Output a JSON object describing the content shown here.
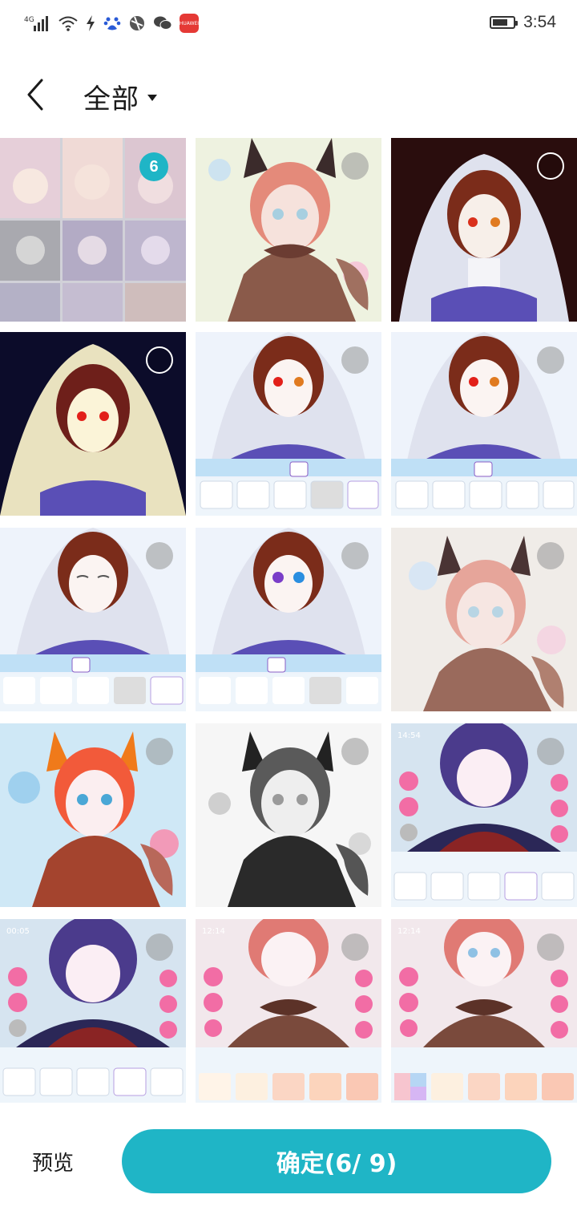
{
  "status_bar": {
    "network": "4G",
    "time": "3:54",
    "battery_level": 0.75,
    "badge_text": "HUAWEI"
  },
  "header": {
    "title": "全部"
  },
  "grid": {
    "selected_count_badge": "6",
    "items": [
      {
        "kind": "collage",
        "selected": true
      },
      {
        "kind": "fox",
        "selected": false
      },
      {
        "kind": "veil-dark",
        "selected": false
      },
      {
        "kind": "veil-navy",
        "selected": false
      },
      {
        "kind": "veil-editor-mouth",
        "selected": false
      },
      {
        "kind": "veil-editor-mouth2",
        "selected": false
      },
      {
        "kind": "veil-editor-eyes",
        "selected": false
      },
      {
        "kind": "veil-editor-eyes2",
        "selected": false
      },
      {
        "kind": "fox-pale",
        "selected": false
      },
      {
        "kind": "fox-bright",
        "selected": false
      },
      {
        "kind": "fox-bw",
        "selected": false
      },
      {
        "kind": "purple-editor",
        "selected": false
      },
      {
        "kind": "purple-editor-2",
        "selected": false
      },
      {
        "kind": "fox-editor",
        "selected": false
      },
      {
        "kind": "fox-editor-2",
        "selected": false
      }
    ],
    "timestamps": [
      "14:54",
      "00:05",
      "12:14",
      "12:14"
    ]
  },
  "bottom": {
    "preview_label": "预览",
    "confirm_label": "确定(6/ 9)"
  },
  "colors": {
    "accent": "#1fb5c6"
  }
}
